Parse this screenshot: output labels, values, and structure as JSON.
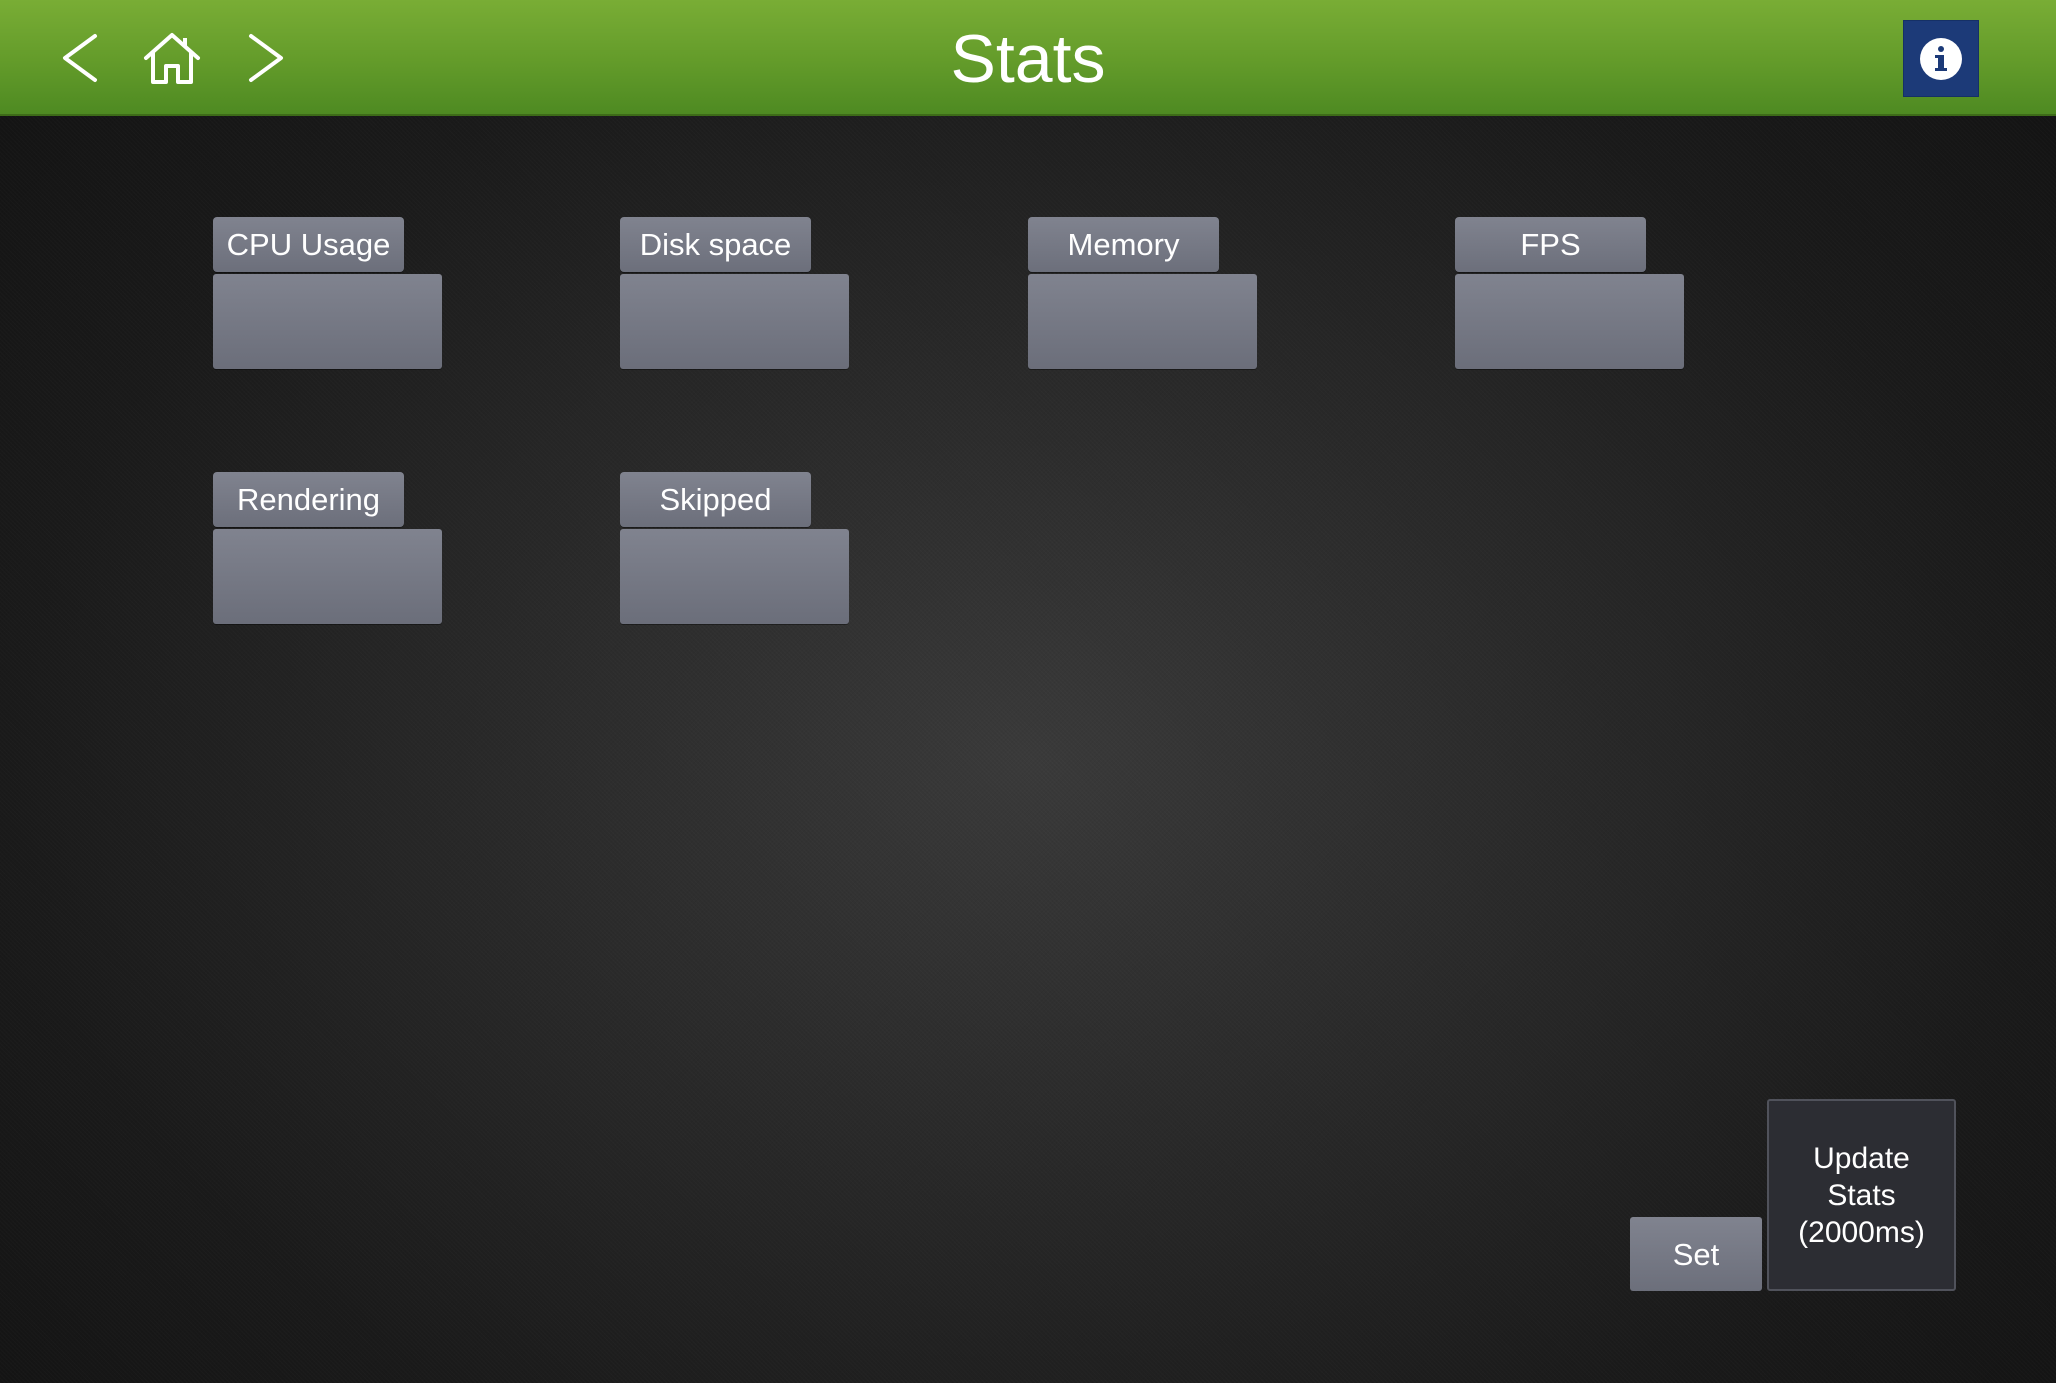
{
  "header": {
    "title": "Stats",
    "back_icon": "chevron-left-icon",
    "home_icon": "home-icon",
    "forward_icon": "chevron-right-icon",
    "info_icon": "info-icon",
    "bar_color": "#639b2a",
    "info_color": "#1c3a78"
  },
  "stats": [
    {
      "label": "CPU Usage",
      "value": ""
    },
    {
      "label": "Disk space",
      "value": ""
    },
    {
      "label": "Memory",
      "value": ""
    },
    {
      "label": "FPS",
      "value": ""
    },
    {
      "label": "Rendering",
      "value": ""
    },
    {
      "label": "Skipped",
      "value": ""
    }
  ],
  "controls": {
    "set_label": "Set",
    "update_line1": "Update",
    "update_line2": "Stats",
    "update_line3": "(2000ms)"
  }
}
